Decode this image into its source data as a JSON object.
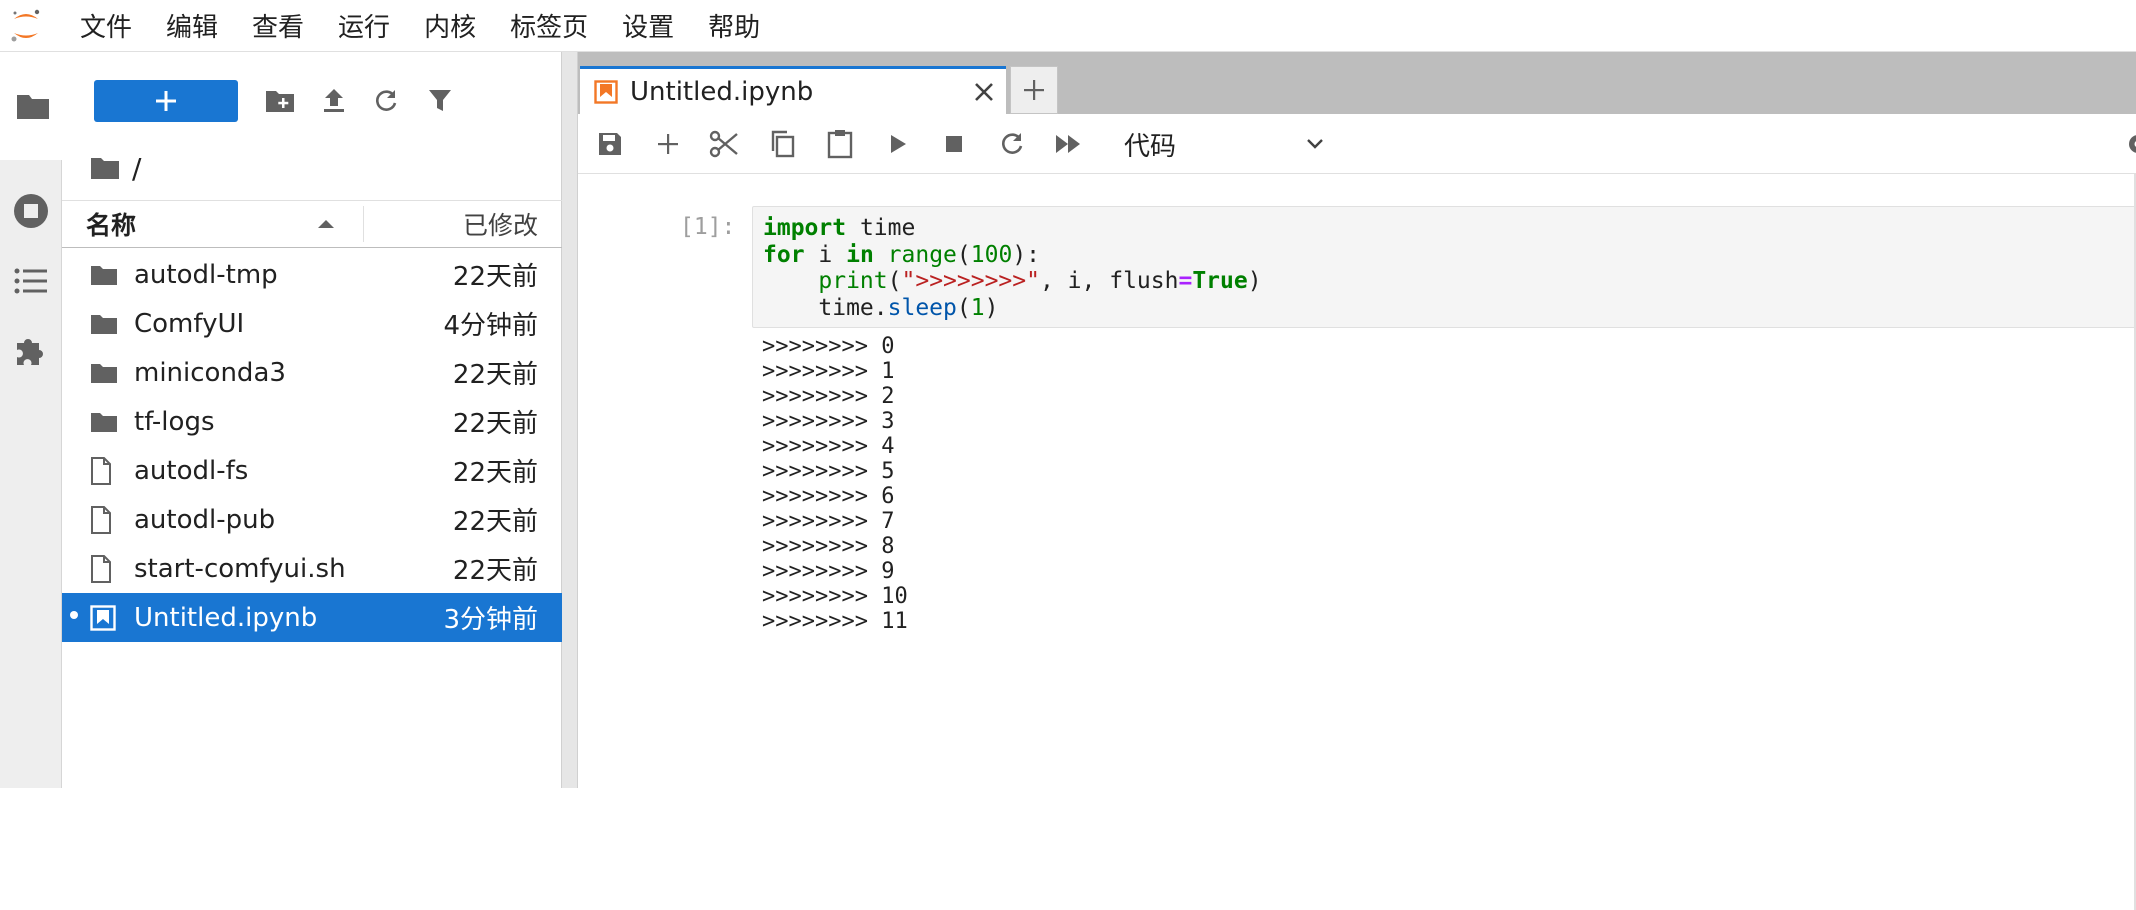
{
  "menu": [
    "文件",
    "编辑",
    "查看",
    "运行",
    "内核",
    "标签页",
    "设置",
    "帮助"
  ],
  "file_browser": {
    "path": "/",
    "header": {
      "name": "名称",
      "modified": "已修改"
    },
    "files": [
      {
        "name": "autodl-tmp",
        "modified": "22天前",
        "type": "folder"
      },
      {
        "name": "ComfyUI",
        "modified": "4分钟前",
        "type": "folder"
      },
      {
        "name": "miniconda3",
        "modified": "22天前",
        "type": "folder"
      },
      {
        "name": "tf-logs",
        "modified": "22天前",
        "type": "folder"
      },
      {
        "name": "autodl-fs",
        "modified": "22天前",
        "type": "file"
      },
      {
        "name": "autodl-pub",
        "modified": "22天前",
        "type": "file"
      },
      {
        "name": "start-comfyui.sh",
        "modified": "22天前",
        "type": "file"
      },
      {
        "name": "Untitled.ipynb",
        "modified": "3分钟前",
        "type": "notebook",
        "selected": true
      }
    ]
  },
  "tab": {
    "title": "Untitled.ipynb"
  },
  "toolbar": {
    "cell_type": "代码"
  },
  "cell": {
    "prompt": "[1]:",
    "output_prefix": ">>>>>>>>",
    "output_lines": [
      "0",
      "1",
      "2",
      "3",
      "4",
      "5",
      "6",
      "7",
      "8",
      "9",
      "10",
      "11"
    ]
  },
  "colors": {
    "accent": "#1976d2",
    "logo": "#f37726"
  }
}
